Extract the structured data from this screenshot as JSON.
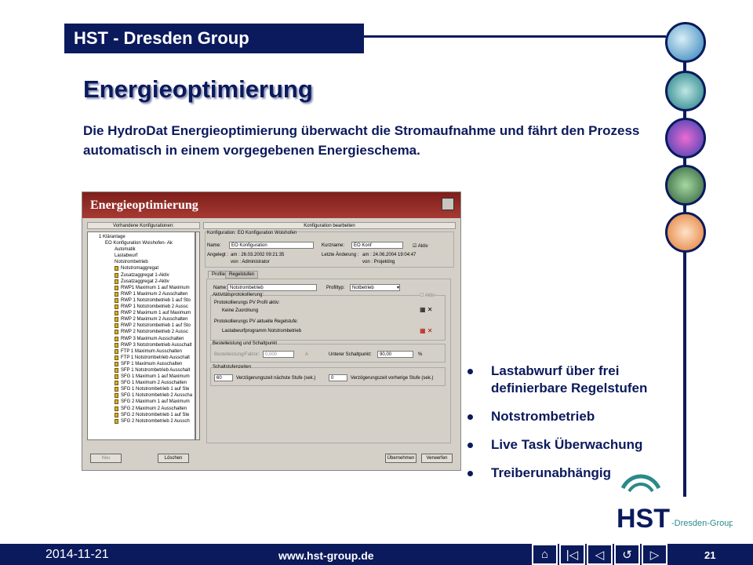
{
  "header": {
    "title": "HST - Dresden Group"
  },
  "slide": {
    "title": "Energieoptimierung",
    "intro": "Die HydroDat Energieoptimierung überwacht die Stromaufnahme und fährt den Prozess automatisch in einem vorgegebenen Energieschema."
  },
  "app": {
    "window_title": "Energieoptimierung",
    "left_header": "Vorhandene Konfigurationen:",
    "right_header": "Konfiguration bearbeiten",
    "config_group": "Konfiguration: EO Konfiguration Woishofen",
    "name_label": "Name:",
    "name_value": "EO Konfiguration",
    "short_label": "Kurzname:",
    "short_value": "EO Konf",
    "active_label": "Aktiv",
    "created_label": "Angelegt :",
    "created_value": "am : 26.03.2002 09:21:35",
    "created_by": "von : Administrator",
    "changed_label": "Letzte Änderung :",
    "changed_value": "am : 24.06.2004 19:04:47",
    "changed_by": "von : Projekting",
    "tabs": [
      "Profile",
      "Regelstufen"
    ],
    "profile_name_label": "Name:",
    "profile_name_value": "Notstrombetrieb",
    "profile_type_label": "Profiltyp:",
    "profile_type_value": "Notbetrieb",
    "activity_group": "Aktivitätsprotokollierung:",
    "activity_check": "Aktiv",
    "pv_profile_label": "Protokollierungs PV Profil aktiv:",
    "pv_profile_value": "Keine Zuordnung",
    "pv_stage_label": "Protokollierungs PV aktuelle Regelstufe:",
    "pv_stage_value": "Lastabwurfprogramm Notstrombetrieb",
    "order_group": "Bestelleistung und Schaltpunkt",
    "order_label": "Bestelleistung/Faktor:",
    "order_value": "0,000",
    "order_unit": "A",
    "lower_label": "Unterer Schaltpunkt:",
    "lower_value": "90,00",
    "lower_unit": "%",
    "switch_group": "Schaltstufenzeiten",
    "delay_next_value": "60",
    "delay_next_label": "Verzögerungszeit nächste Stufe (sek.)",
    "delay_prev_value": "0",
    "delay_prev_label": "Verzögerungszeit vorherige Stufe (sek.)",
    "btn_new": "Neu",
    "btn_delete": "Löschen",
    "btn_apply": "Übernehmen",
    "btn_discard": "Verwerfen",
    "tree": [
      "1 Kläranlage",
      "EO Konfiguration Woishofen- Ak",
      "Automatik",
      "Lastabwurf",
      "Notstrombetrieb",
      "Notstromaggregat",
      "Zusatzaggregat 1-Aktiv",
      "Zusatzaggregat 2-Aktiv",
      "RWP1 Maximum 1 auf Maximum",
      "RWP 1 Maximum 2 Ausschalten",
      "RWP 1 Notstrombetrieb 1 auf Sto",
      "RWP 1 Notstrombetrieb 2 Aussc",
      "RWP 2 Maximum 1 auf Maximum",
      "RWP 2 Maximum 2 Ausschalten",
      "RWP 2 Notstrombetrieb 1 auf Sto",
      "RWP 2 Notstrombetrieb 2 Aussc",
      "RWP 3 Maximum Ausschalten",
      "RWP 3 Notstrombetrieb Ausschalt",
      "FTP 1 Maximum Ausschalten",
      "FTP 1 Notstrombetrieb Ausschalt",
      "SFP 1 Maximum Ausschalten",
      "SFP 1 Notstrombetrieb Ausschalt",
      "SFG 1 Maximum 1 auf Maximum",
      "SFG 1 Maximum 2 Ausschalten",
      "SFG 1 Notstrombetrieb 1 auf Ste",
      "SFG 1 Notstrombetrieb 2 Ausscha",
      "SFG 2 Maximum 1 auf Maximum",
      "SFG 2 Maximum 2 Ausschalten",
      "SFG 2 Notstrombetrieb 1 auf Ste",
      "SFG 2 Notstrombetrieb 2 Aussch"
    ]
  },
  "bullets": [
    "Lastabwurf über frei definierbare Regelstufen",
    "Notstrombetrieb",
    "Live Task Überwachung",
    "Treiberunabhängig"
  ],
  "footer": {
    "date": "2014-11-21",
    "url": "www.hst-group.de",
    "page": "21"
  },
  "logo": {
    "text": "HST",
    "sub": "-Dresden-Group"
  },
  "colors": {
    "navy": "#0b1a5c",
    "teal": "#2a8a8a",
    "titlebar": "#8f2a25"
  }
}
